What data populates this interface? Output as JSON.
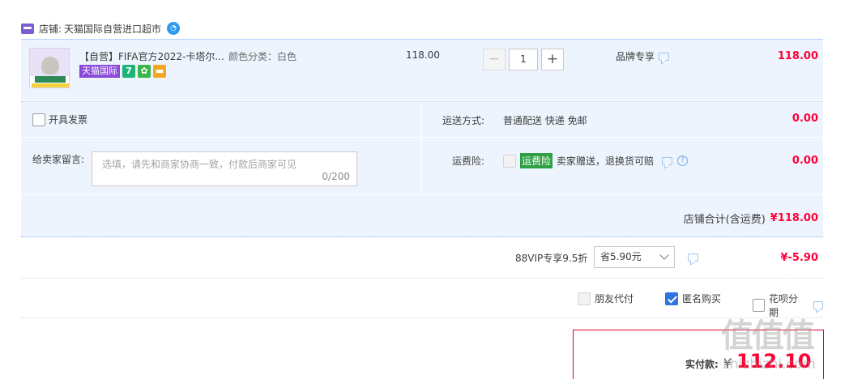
{
  "shop": {
    "label": "店铺:",
    "name": "天猫国际自营进口超市"
  },
  "item": {
    "title": "【自营】FIFA官方2022-卡塔尔...",
    "sku": "颜色分类：白色",
    "tag": "天猫国际",
    "tag_icons": [
      "7",
      "✿",
      "▬"
    ],
    "unit_price": "118.00",
    "quantity": "1",
    "decrement": "−",
    "increment": "+",
    "promo": "品牌专享",
    "subtotal": "118.00"
  },
  "invoice": {
    "label": "开具发票"
  },
  "shipping": {
    "label": "运送方式:",
    "value": "普通配送 快递 免邮",
    "amount": "0.00"
  },
  "message": {
    "label": "给卖家留言:",
    "placeholder": "选填，请先和商家协商一致，付款后商家可见",
    "counter": "0/200"
  },
  "insurance": {
    "label": "运费险:",
    "tag": "运费险",
    "desc": "卖家赠送，退换货可赔",
    "help": "?",
    "amount": "0.00"
  },
  "shop_total": {
    "label": "店铺合计(含运费)",
    "amount": "¥118.00"
  },
  "vip": {
    "label": "88VIP专享9.5折",
    "selected": "省5.90元",
    "amount": "¥-5.90"
  },
  "options": {
    "friend_pay": "朋友代付",
    "anonymous": "匿名购买",
    "huabei": "花呗分期"
  },
  "payment": {
    "label": "实付款:",
    "currency": "¥",
    "amount": "112.10"
  },
  "colors": {
    "accent_red": "#ff0036",
    "accent_blue": "#2f74e0",
    "tmall_purple": "#8a4ad8",
    "row_bg": "#eef4fd"
  }
}
